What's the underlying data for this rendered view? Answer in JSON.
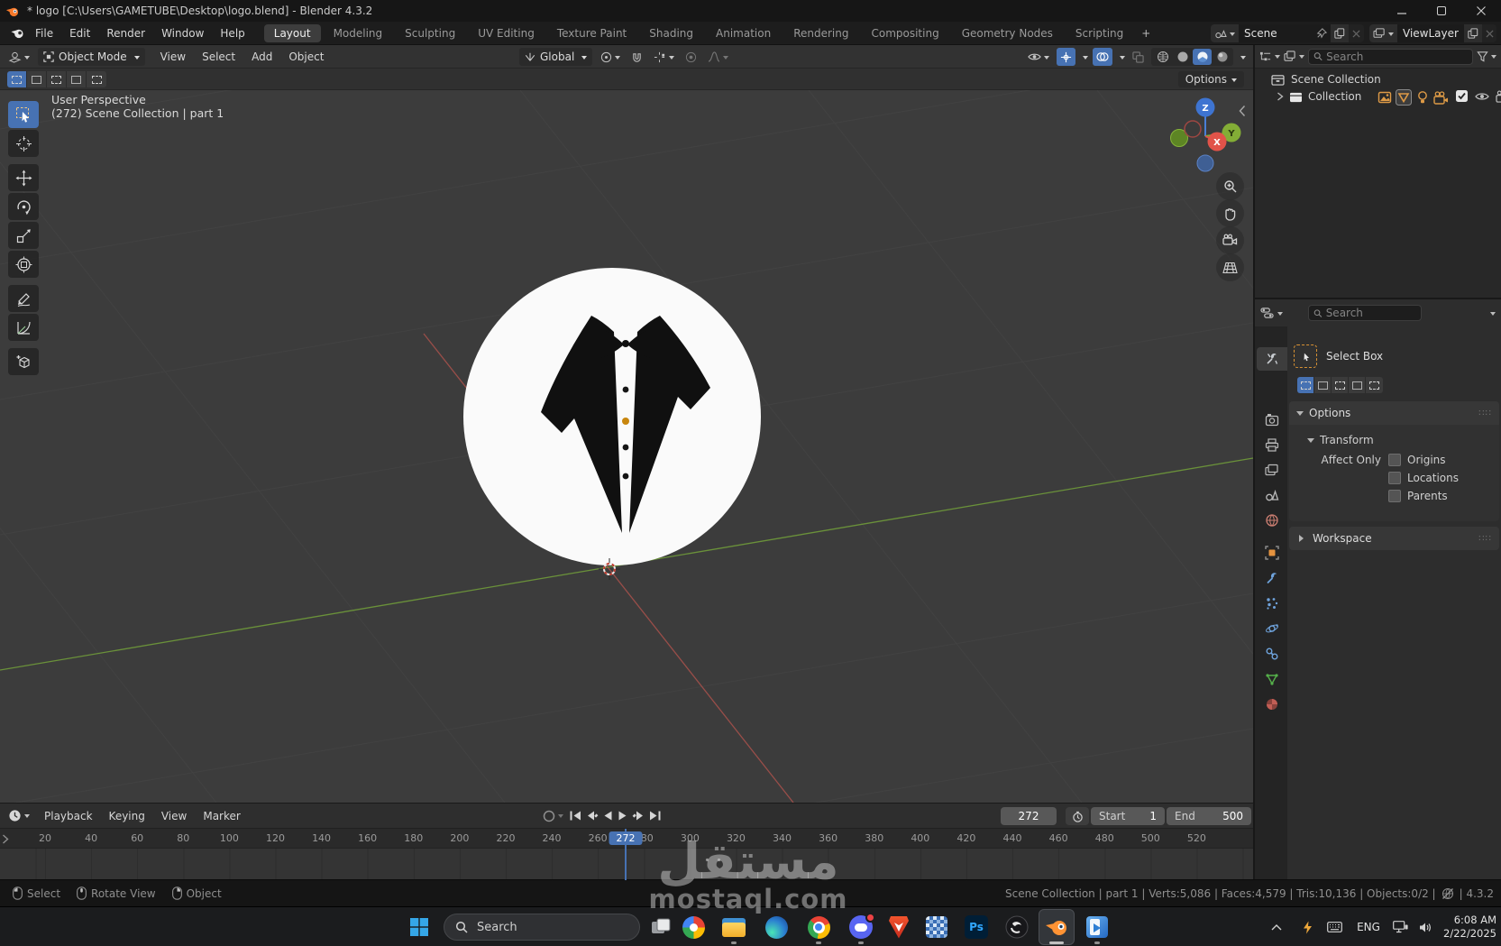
{
  "window": {
    "title": "* logo [C:\\Users\\GAMETUBE\\Desktop\\logo.blend] - Blender 4.3.2"
  },
  "topbar": {
    "menus": [
      "File",
      "Edit",
      "Render",
      "Window",
      "Help"
    ],
    "workspaces": [
      "Layout",
      "Modeling",
      "Sculpting",
      "UV Editing",
      "Texture Paint",
      "Shading",
      "Animation",
      "Rendering",
      "Compositing",
      "Geometry Nodes",
      "Scripting"
    ],
    "active_workspace": "Layout",
    "add_workspace": "+",
    "scene_name": "Scene",
    "viewlayer_name": "ViewLayer"
  },
  "viewport": {
    "header": {
      "mode": "Object Mode",
      "menus": [
        "View",
        "Select",
        "Add",
        "Object"
      ],
      "orientation": "Global"
    },
    "options_button": "Options",
    "overlay": {
      "line1": "User Perspective",
      "line2": "(272) Scene Collection | part 1"
    },
    "gizmo": {
      "x": "X",
      "y": "Y",
      "z": "Z"
    }
  },
  "outliner": {
    "search_placeholder": "Search",
    "scene_collection": "Scene Collection",
    "collection": "Collection"
  },
  "properties": {
    "search_placeholder": "Search",
    "tool_name": "Select Box",
    "options_panel": "Options",
    "transform_panel": "Transform",
    "affect_only_label": "Affect Only",
    "checkboxes": [
      "Origins",
      "Locations",
      "Parents"
    ],
    "workspace_panel": "Workspace"
  },
  "timeline": {
    "menus": [
      "Playback",
      "Keying",
      "View",
      "Marker"
    ],
    "ticks": [
      20,
      40,
      60,
      80,
      100,
      120,
      140,
      160,
      180,
      200,
      220,
      240,
      260,
      280,
      300,
      320,
      340,
      360,
      380,
      400,
      420,
      440,
      460,
      480,
      500,
      520
    ],
    "current_frame": "272",
    "start_label": "Start",
    "start_value": "1",
    "end_label": "End",
    "end_value": "500"
  },
  "statusbar": {
    "hints": [
      {
        "button": "left",
        "label": "Select"
      },
      {
        "button": "middle",
        "label": "Rotate View"
      },
      {
        "button": "right",
        "label": "Object"
      }
    ],
    "stats": "Scene Collection | part 1 | Verts:5,086 | Faces:4,579 | Tris:10,136 | Objects:0/2 |",
    "version": "| 4.3.2"
  },
  "taskbar": {
    "search_placeholder": "Search",
    "photoshop_label": "Ps",
    "language": "ENG",
    "time": "6:08 AM",
    "date": "2/22/2025"
  },
  "watermark": {
    "arabic": "مستقل",
    "latin": "mostaql.com"
  },
  "colors": {
    "accent_blue": "#4772b3",
    "object_orange": "#e5933f",
    "axis_green": "#76a73a",
    "axis_red": "#b8544e",
    "gold_button": "#c8860e"
  }
}
